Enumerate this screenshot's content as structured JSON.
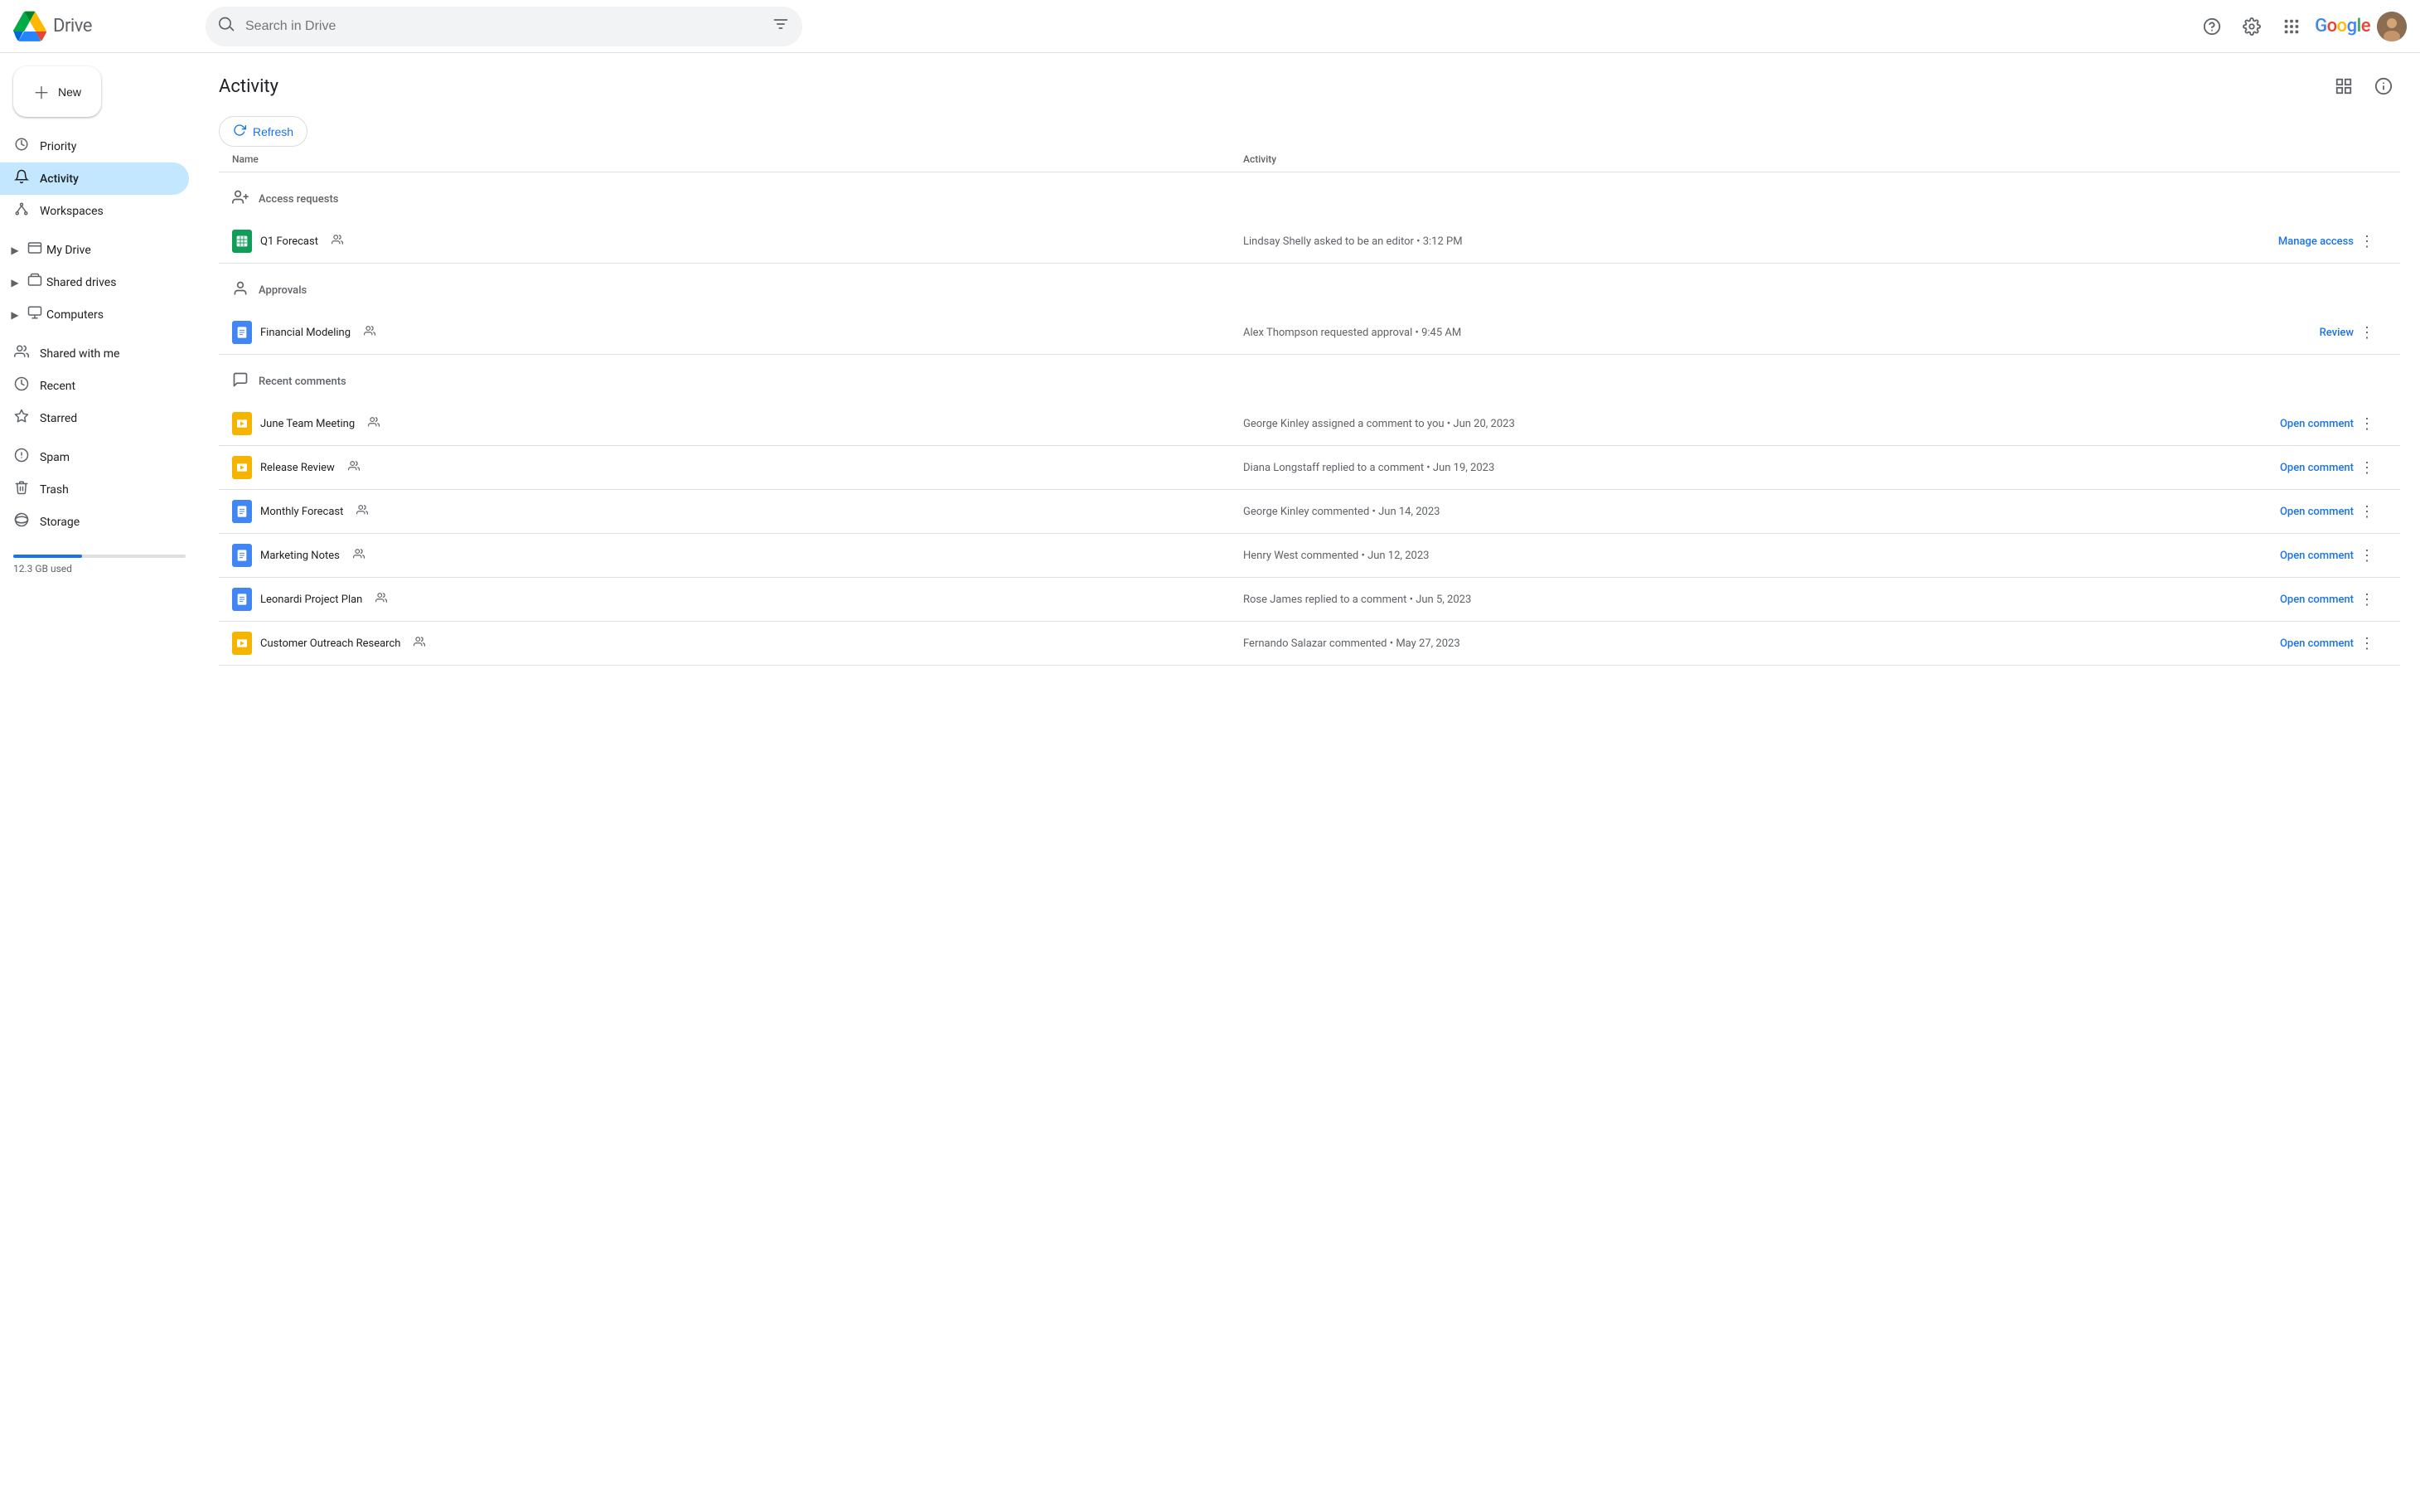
{
  "header": {
    "logo_text": "Drive",
    "search_placeholder": "Search in Drive",
    "google_label": "Google"
  },
  "sidebar": {
    "new_button": "New",
    "items": [
      {
        "id": "priority",
        "label": "Priority",
        "icon": "clock_outline"
      },
      {
        "id": "activity",
        "label": "Activity",
        "icon": "bell",
        "active": true
      },
      {
        "id": "workspaces",
        "label": "Workspaces",
        "icon": "workspaces"
      }
    ],
    "expandable": [
      {
        "id": "my-drive",
        "label": "My Drive",
        "icon": "folder"
      },
      {
        "id": "shared-drives",
        "label": "Shared drives",
        "icon": "drive"
      },
      {
        "id": "computers",
        "label": "Computers",
        "icon": "computer"
      }
    ],
    "bottom_items": [
      {
        "id": "shared-with-me",
        "label": "Shared with me",
        "icon": "person"
      },
      {
        "id": "recent",
        "label": "Recent",
        "icon": "clock"
      },
      {
        "id": "starred",
        "label": "Starred",
        "icon": "star"
      },
      {
        "id": "spam",
        "label": "Spam",
        "icon": "spam"
      },
      {
        "id": "trash",
        "label": "Trash",
        "icon": "trash"
      },
      {
        "id": "storage",
        "label": "Storage",
        "icon": "cloud"
      }
    ],
    "storage_used": "12.3 GB used",
    "storage_percent": 40
  },
  "main": {
    "title": "Activity",
    "refresh_label": "Refresh",
    "columns": {
      "name": "Name",
      "activity": "Activity"
    },
    "sections": [
      {
        "id": "access-requests",
        "title": "Access requests",
        "icon": "person_add",
        "rows": [
          {
            "id": "q1-forecast",
            "name": "Q1 Forecast",
            "type": "sheets",
            "shared": true,
            "activity": "Lindsay Shelly asked to be an editor • 3:12 PM",
            "action": "Manage access"
          }
        ]
      },
      {
        "id": "approvals",
        "title": "Approvals",
        "icon": "person_check",
        "rows": [
          {
            "id": "financial-modeling",
            "name": "Financial Modeling",
            "type": "docs",
            "shared": true,
            "activity": "Alex Thompson requested approval • 9:45 AM",
            "action": "Review"
          }
        ]
      },
      {
        "id": "recent-comments",
        "title": "Recent comments",
        "icon": "comment",
        "rows": [
          {
            "id": "june-team-meeting",
            "name": "June Team Meeting",
            "type": "slides",
            "shared": true,
            "activity": "George Kinley assigned a comment to you • Jun 20, 2023",
            "action": "Open comment"
          },
          {
            "id": "release-review",
            "name": "Release Review",
            "type": "slides",
            "shared": true,
            "activity": "Diana Longstaff replied to a comment • Jun 19, 2023",
            "action": "Open comment"
          },
          {
            "id": "monthly-forecast",
            "name": "Monthly Forecast",
            "type": "docs",
            "shared": true,
            "activity": "George Kinley commented • Jun 14, 2023",
            "action": "Open comment"
          },
          {
            "id": "marketing-notes",
            "name": "Marketing Notes",
            "type": "docs",
            "shared": true,
            "activity": "Henry West commented • Jun 12, 2023",
            "action": "Open comment"
          },
          {
            "id": "leonardi-project-plan",
            "name": "Leonardi Project Plan",
            "type": "docs",
            "shared": true,
            "activity": "Rose James replied to a comment • Jun 5, 2023",
            "action": "Open comment"
          },
          {
            "id": "customer-outreach-research",
            "name": "Customer Outreach Research",
            "type": "slides",
            "shared": true,
            "activity": "Fernando Salazar commented • May 27, 2023",
            "action": "Open comment"
          }
        ]
      }
    ]
  }
}
